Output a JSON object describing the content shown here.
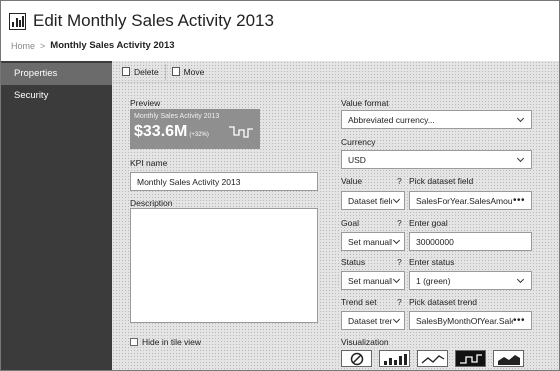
{
  "header": {
    "title": "Edit Monthly Sales Activity 2013",
    "breadcrumb_home": "Home",
    "breadcrumb_sep": ">",
    "breadcrumb_current": "Monthly Sales Activity 2013"
  },
  "sidebar": {
    "items": [
      {
        "label": "Properties",
        "active": true
      },
      {
        "label": "Security",
        "active": false
      }
    ]
  },
  "toolbar": {
    "delete_label": "Delete",
    "move_label": "Move"
  },
  "left": {
    "preview_label": "Preview",
    "tile": {
      "name": "Monthly Sales Activity 2013",
      "value": "$33.6M",
      "change": "(+32%)"
    },
    "kpi_name_label": "KPI name",
    "kpi_name_value": "Monthly Sales Activity 2013",
    "description_label": "Description",
    "hide_label": "Hide in tile view"
  },
  "right": {
    "value_format_label": "Value format",
    "value_format_value": "Abbreviated currency...",
    "currency_label": "Currency",
    "currency_value": "USD",
    "value_label": "Value",
    "value_select": "Dataset field",
    "pick_field_label": "Pick dataset field",
    "pick_field_value": "SalesForYear.SalesAmount",
    "goal_label": "Goal",
    "goal_select": "Set manually",
    "enter_goal_label": "Enter goal",
    "enter_goal_value": "30000000",
    "status_label": "Status",
    "status_select": "Set manually",
    "enter_status_label": "Enter status",
    "enter_status_value": "1 (green)",
    "trend_label": "Trend set",
    "trend_select": "Dataset trend",
    "pick_trend_label": "Pick dataset trend",
    "pick_trend_value": "SalesByMonthOfYear.SalesA",
    "visualization_label": "Visualization",
    "help": "?"
  },
  "colors": {
    "sidebar_bg": "#3b3b3b",
    "sidebar_active": "#6b6b6b",
    "tile_bg": "#8f8f8f"
  },
  "icons": [
    "chart-logo-icon",
    "delete-icon",
    "move-icon",
    "none-viz-icon",
    "bar-viz-icon",
    "line-viz-icon",
    "step-viz-icon",
    "area-viz-icon"
  ]
}
